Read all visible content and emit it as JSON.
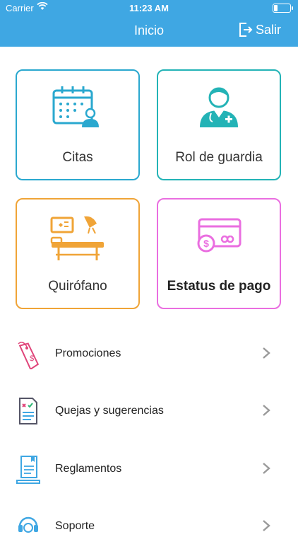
{
  "status_bar": {
    "carrier": "Carrier",
    "time": "11:23 AM"
  },
  "nav": {
    "title": "Inicio",
    "logout_label": "Salir"
  },
  "cards": [
    {
      "label": "Citas",
      "icon": "calendar-doctor-icon",
      "color": "#2aa8cf"
    },
    {
      "label": "Rol de guardia",
      "icon": "doctor-icon",
      "color": "#23b3b6"
    },
    {
      "label": "Quirófano",
      "icon": "operating-room-icon",
      "color": "#f0a437"
    },
    {
      "label": "Estatus de pago",
      "icon": "payment-card-icon",
      "color": "#ea6ee0"
    }
  ],
  "menu": [
    {
      "label": "Promociones",
      "icon": "price-tag-icon"
    },
    {
      "label": "Quejas y sugerencias",
      "icon": "checklist-document-icon"
    },
    {
      "label": "Reglamentos",
      "icon": "rules-book-icon"
    },
    {
      "label": "Soporte",
      "icon": "support-headset-icon"
    }
  ],
  "colors": {
    "header": "#3fa7e3",
    "chevron": "#9a9a9a"
  }
}
